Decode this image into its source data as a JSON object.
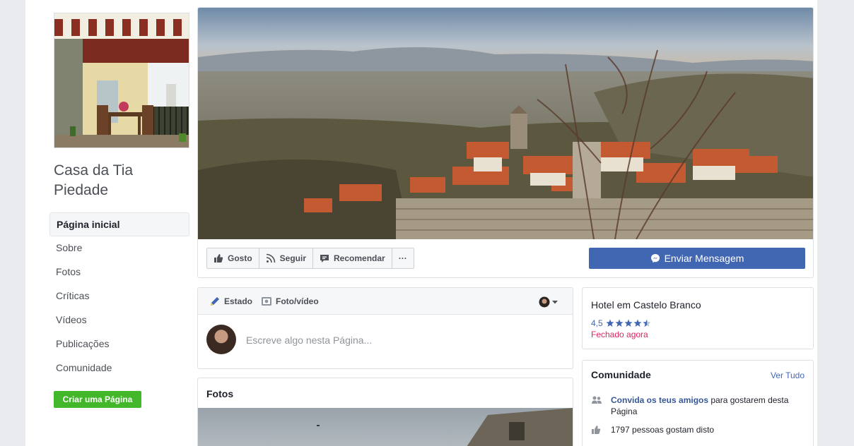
{
  "page": {
    "name": "Casa da Tia Piedade"
  },
  "left_nav": {
    "items": [
      {
        "label": "Página inicial"
      },
      {
        "label": "Sobre"
      },
      {
        "label": "Fotos"
      },
      {
        "label": "Críticas"
      },
      {
        "label": "Vídeos"
      },
      {
        "label": "Publicações"
      },
      {
        "label": "Comunidade"
      }
    ],
    "create_page_label": "Criar uma Página"
  },
  "actions": {
    "like_label": "Gosto",
    "follow_label": "Seguir",
    "recommend_label": "Recomendar",
    "more_label": "···",
    "send_message_label": "Enviar Mensagem"
  },
  "composer": {
    "status_tab": "Estado",
    "photo_tab": "Foto/vídeo",
    "placeholder": "Escreve algo nesta Página..."
  },
  "photos": {
    "title": "Fotos"
  },
  "info": {
    "category": "Hotel em Castelo Branco",
    "rating": "4,5",
    "rating_value": 4.5,
    "rating_max": 5,
    "status": "Fechado agora"
  },
  "community": {
    "title": "Comunidade",
    "see_all": "Ver Tudo",
    "invite_link": "Convida os teus amigos",
    "invite_text": " para gostarem desta Página",
    "likes_text": "1797 pessoas gostam disto"
  },
  "colors": {
    "brand_blue": "#4267b2",
    "create_green": "#42b72a",
    "closed_red": "#e0245e"
  }
}
